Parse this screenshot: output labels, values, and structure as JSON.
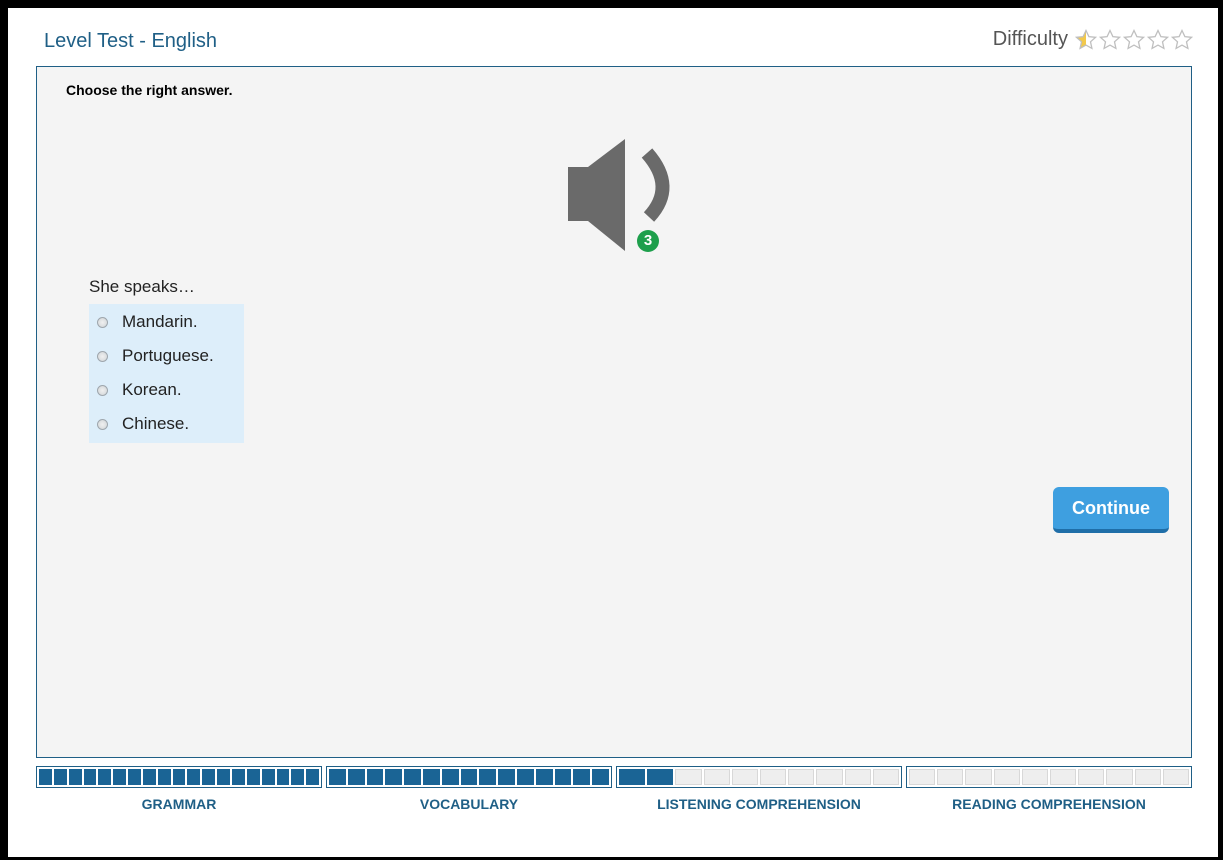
{
  "header": {
    "title": "Level Test - English",
    "difficulty_label": "Difficulty",
    "difficulty_rating": 0.5,
    "difficulty_max": 5
  },
  "question": {
    "instruction": "Choose the right answer.",
    "audio_plays_remaining": "3",
    "prompt": "She speaks…",
    "options": [
      "Mandarin.",
      "Portuguese.",
      "Korean.",
      "Chinese."
    ]
  },
  "actions": {
    "continue_label": "Continue"
  },
  "progress": [
    {
      "label": "GRAMMAR",
      "completed": 19,
      "total": 19
    },
    {
      "label": "VOCABULARY",
      "completed": 15,
      "total": 15
    },
    {
      "label": "LISTENING COMPREHENSION",
      "completed": 2,
      "total": 10
    },
    {
      "label": "READING COMPREHENSION",
      "completed": 0,
      "total": 10
    }
  ],
  "colors": {
    "brand_blue": "#1f5f86",
    "button_blue": "#3e9fe0",
    "badge_green": "#1e9f4c",
    "star_gold": "#f2c94c"
  },
  "icons": {
    "audio": "speaker-icon",
    "difficulty": "star-icon"
  }
}
